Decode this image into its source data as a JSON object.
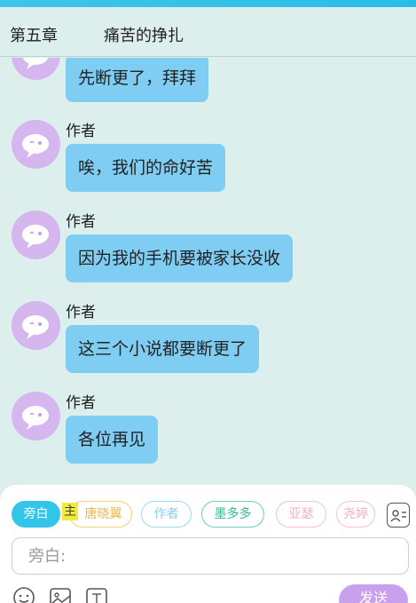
{
  "header": {
    "chapter_number": "第五章",
    "chapter_title": "痛苦的挣扎"
  },
  "messages": [
    {
      "author": "",
      "text": "先断更了，拜拜"
    },
    {
      "author": "作者",
      "text": "唉，我们的命好苦"
    },
    {
      "author": "作者",
      "text": "因为我的手机要被家长没收"
    },
    {
      "author": "作者",
      "text": "这三个小说都要断更了"
    },
    {
      "author": "作者",
      "text": "各位再见"
    }
  ],
  "characters": [
    {
      "label": "旁白",
      "selected": true
    },
    {
      "label": "唐晓翼",
      "selected": false
    },
    {
      "label": "作者",
      "selected": false
    },
    {
      "label": "墨多多",
      "selected": false
    },
    {
      "label": "亚瑟",
      "selected": false
    },
    {
      "label": "尧婷",
      "selected": false
    }
  ],
  "host_tag": "主",
  "input": {
    "placeholder": "旁白:"
  },
  "toolbar": {
    "send_label": "发送"
  },
  "icons": {
    "emoji": "emoji-icon",
    "image": "image-icon",
    "tag": "tag-icon",
    "contacts": "contact-card-icon",
    "avatar": "chat-bubble-avatar-icon"
  },
  "colors": {
    "accent": "#33c4ea",
    "bubble": "#7fcdf2",
    "avatar": "#d6b6ee",
    "send": "#c8a0ee",
    "background": "#dcefed"
  }
}
